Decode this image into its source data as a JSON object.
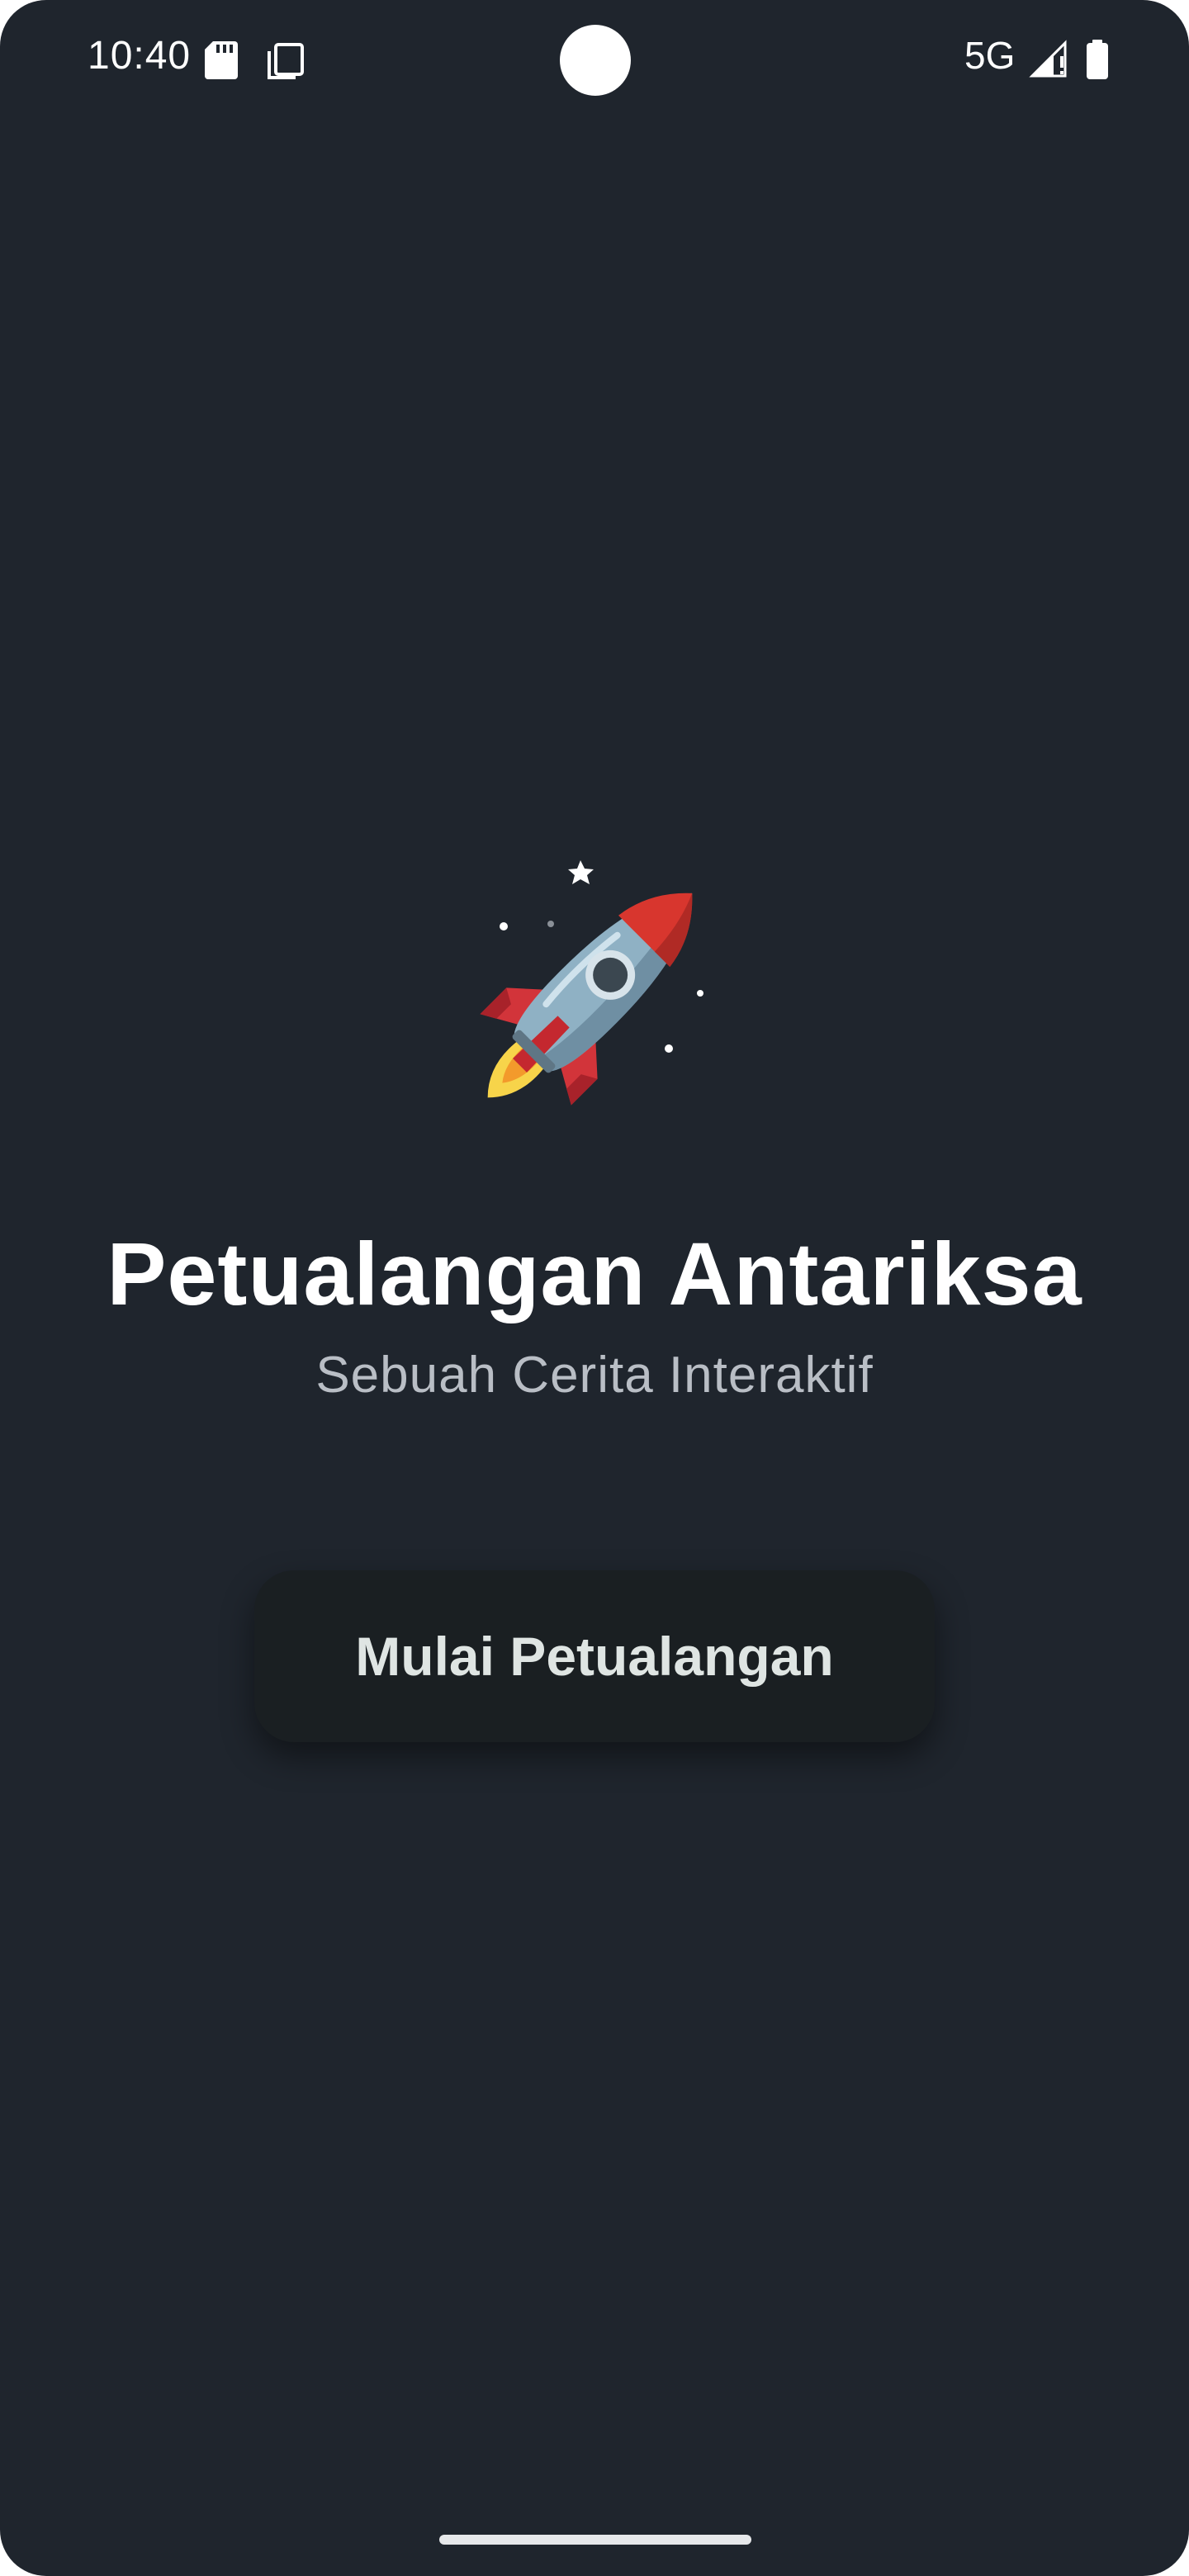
{
  "status_bar": {
    "time": "10:40",
    "network": "5G",
    "icons": [
      "sd-card-icon",
      "screenshot-icon",
      "signal-icon",
      "battery-icon"
    ]
  },
  "hero": {
    "icon": "rocket-icon",
    "title": "Petualangan Antariksa",
    "subtitle": "Sebuah Cerita Interaktif"
  },
  "actions": {
    "start_label": "Mulai Petualangan"
  },
  "colors": {
    "background": "#1f252d",
    "button": "#1a1f22",
    "button_text": "#dfe5e3",
    "subtitle": "#b9bec5"
  }
}
